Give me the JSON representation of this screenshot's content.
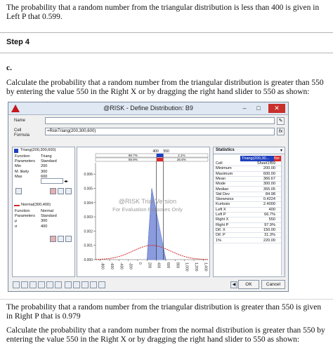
{
  "doc": {
    "intro_text": "The probability that a random number from the triangular distribution is less than 400 is given in Left P that 0.599.",
    "step_label": "Step 4",
    "part_label": "c.",
    "question_text_1": "Calculate the probability that a random number from the triangular distribution is greater than 550 by entering the value 550 in the Right X or by dragging the right hand slider to 550 as shown:",
    "answer_text": "The probability that a random number from the triangular distribution is greater than 550 is given in Right P that is 0.979",
    "question_text_2": "Calculate the probability that a random number from the normal distribution is greater than 550 by entering the value 550 in the Right X or by dragging the right hand slider to 550 as shown:"
  },
  "window": {
    "title": "@RISK - Define Distribution: B9",
    "min_label": "–",
    "max_label": "□",
    "close_label": "✕"
  },
  "name_label": "Name",
  "cell_formula_label_1": "Cell",
  "cell_formula_label_2": "Formula",
  "cell_formula_value": "=RiskTriang(200,300,600)",
  "left_panel": {
    "triang": {
      "title": "Triang(200,300,600)",
      "rows": [
        {
          "k": "Function",
          "v": "Triang"
        },
        {
          "k": "Parameters",
          "v": "Standard"
        },
        {
          "k": "Min",
          "v": "200"
        },
        {
          "k": "M. likely",
          "v": "300"
        },
        {
          "k": "Max",
          "v": "600"
        }
      ]
    },
    "normal": {
      "title": "Normal(300,400)",
      "rows": [
        {
          "k": "Function",
          "v": "Normal"
        },
        {
          "k": "Parameters",
          "v": "Standard"
        },
        {
          "k": "μ",
          "v": "300"
        },
        {
          "k": "σ",
          "v": "400"
        }
      ]
    }
  },
  "chart_top": {
    "left_x": "400",
    "right_x": "550",
    "triang_left_p": "66.7%",
    "triang_mid_p": "",
    "triang_right_p": "2.1%",
    "normal_left_p": "59.9%",
    "normal_right_p": "26.6%"
  },
  "watermark": {
    "line1": "@RISK Trial Version",
    "line2": "For Evaluation Purposes Only"
  },
  "chart_data": {
    "type": "area",
    "title": "",
    "y_ticks": [
      "0.006",
      "0.005",
      "0.004",
      "0.003",
      "0.002",
      "0.001",
      "0.000"
    ],
    "x_ticks": [
      "-800",
      "-600",
      "-400",
      "-200",
      "0",
      "200",
      "400",
      "600",
      "800",
      "1,000",
      "1,200",
      "1,400"
    ],
    "series": [
      {
        "name": "Triang(200,300,600)",
        "color": "#1f3fbf",
        "values_ref": "triangular density: min 200, mode 300, max 600"
      },
      {
        "name": "Normal(300,400)",
        "color": "#d42a2a",
        "values_ref": "normal density: mean 300, sd 400"
      }
    ],
    "markers": {
      "left_x": 400,
      "right_x": 550
    }
  },
  "stats": {
    "header": "Statistics",
    "col1_header": "Triang(200,30...",
    "col2_header": "Nor",
    "rows": [
      {
        "k": "Cell",
        "v": "Sheet1!B9"
      },
      {
        "k": "Minimum",
        "v": "200.00"
      },
      {
        "k": "Maximum",
        "v": "600.00"
      },
      {
        "k": "Mean",
        "v": "366.67"
      },
      {
        "k": "Mode",
        "v": "300.00"
      },
      {
        "k": "Median",
        "v": "355.05"
      },
      {
        "k": "Std Dev",
        "v": "84.98"
      },
      {
        "k": "Skewness",
        "v": "0.4224"
      },
      {
        "k": "Kurtosis",
        "v": "2.4000"
      },
      {
        "k": "Left X",
        "v": "400"
      },
      {
        "k": "Left P",
        "v": "66.7%"
      },
      {
        "k": "Right X",
        "v": "550"
      },
      {
        "k": "Right P",
        "v": "97.9%"
      },
      {
        "k": "Dif. X",
        "v": "150.00"
      },
      {
        "k": "Dif. P",
        "v": "31.3%"
      },
      {
        "k": "1%",
        "v": "220.00"
      }
    ]
  },
  "buttons": {
    "ok": "OK",
    "cancel": "Cancel"
  },
  "colors": {
    "triang": "#1f3fbf",
    "normal": "#d42a2a",
    "accent": "#c4161c"
  }
}
